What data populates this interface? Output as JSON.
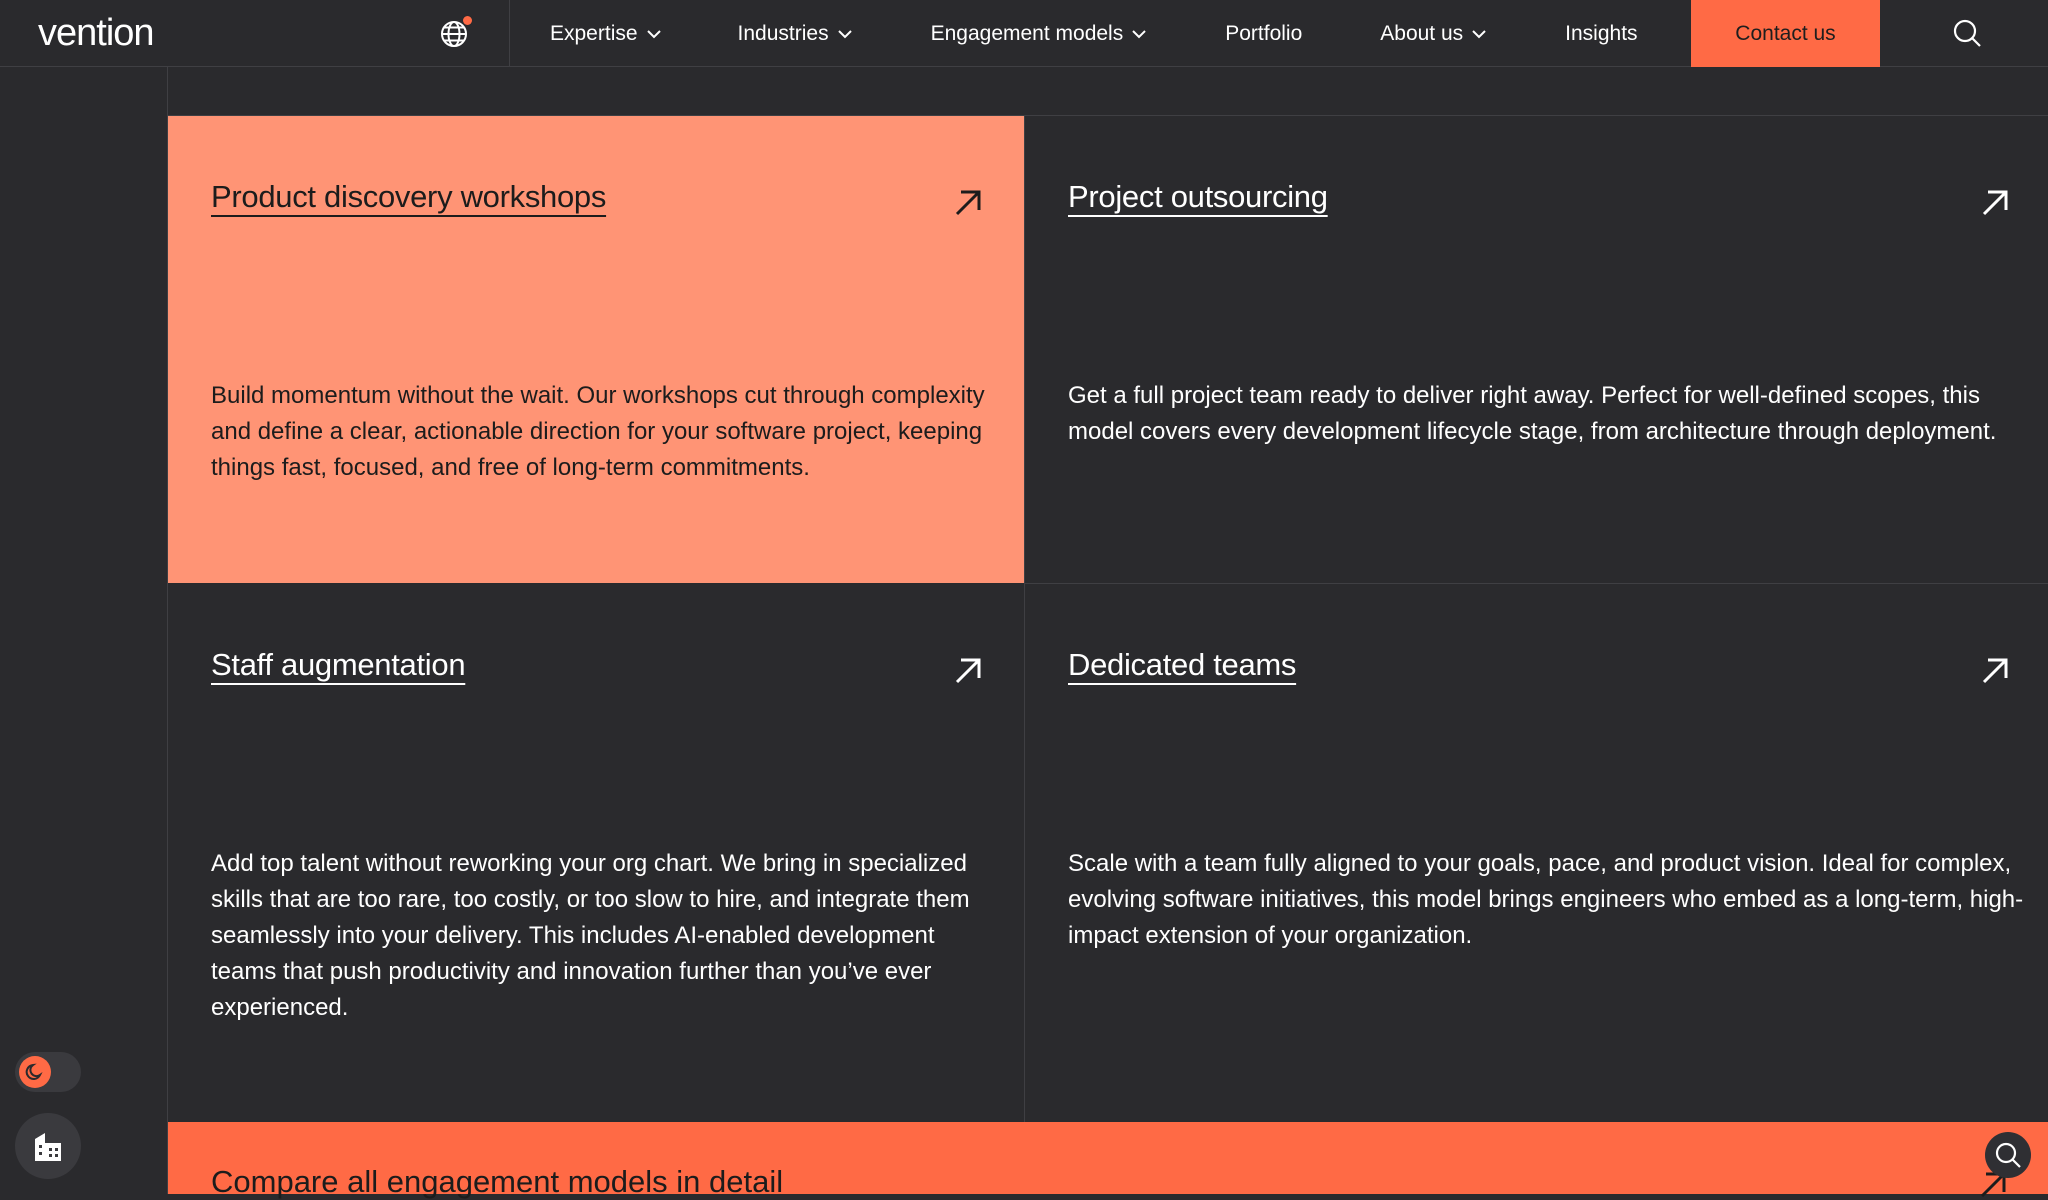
{
  "header": {
    "logo": "vention",
    "nav": [
      {
        "label": "Expertise",
        "has_dropdown": true
      },
      {
        "label": "Industries",
        "has_dropdown": true
      },
      {
        "label": "Engagement models",
        "has_dropdown": true
      },
      {
        "label": "Portfolio",
        "has_dropdown": false
      },
      {
        "label": "About us",
        "has_dropdown": true
      },
      {
        "label": "Insights",
        "has_dropdown": false
      }
    ],
    "contact_label": "Contact us",
    "icons": {
      "globe": "globe-icon",
      "search": "search-icon"
    }
  },
  "colors": {
    "background": "#2a2a2d",
    "accent": "#ff6a45",
    "highlight_card": "#ff9475",
    "divider": "#3f3f43"
  },
  "cards": [
    {
      "title": "Product discovery workshops",
      "description": "Build momentum without the wait. Our workshops cut through complexity and define a clear, actionable direction for your software project, keeping things fast, focused, and free of long-term commitments.",
      "highlighted": true
    },
    {
      "title": "Project outsourcing",
      "description": "Get a full project team ready to deliver right away. Perfect for well-defined scopes, this model covers every development lifecycle stage, from architecture through deployment.",
      "highlighted": false
    },
    {
      "title": "Staff augmentation",
      "description": "Add top talent without reworking your org chart. We bring in specialized skills that are too rare, too costly, or too slow to hire, and integrate them seamlessly into your delivery. This includes AI-enabled development teams that push productivity and innovation further than you’ve ever experienced.",
      "highlighted": false
    },
    {
      "title": "Dedicated teams",
      "description": "Scale with a team fully aligned to your goals, pace, and product vision. Ideal for complex, evolving software initiatives, this model brings engineers who embed as a long-term, high-impact extension of your organization.",
      "highlighted": false
    }
  ],
  "compare_bar": {
    "label": "Compare all engagement models in detail"
  },
  "floating": {
    "theme_toggle_icon": "moon-icon",
    "building_icon": "building-icon",
    "chat_icon": "chat-search-icon"
  }
}
